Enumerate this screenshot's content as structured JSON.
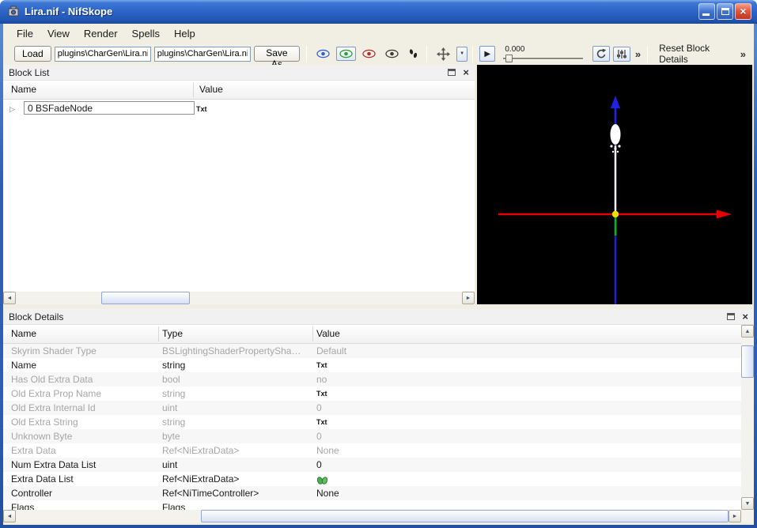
{
  "glyphs": {
    "close_x": "×",
    "overflow": "»",
    "dropdown": "▼",
    "play": "▶",
    "scroll_up": "▲",
    "scroll_down": "▼",
    "scroll_left": "◄",
    "scroll_right": "►",
    "expand": "▷"
  },
  "window": {
    "title": "Lira.nif - NifSkope"
  },
  "menu": {
    "items": [
      "File",
      "View",
      "Render",
      "Spells",
      "Help"
    ]
  },
  "toolbar": {
    "load_label": "Load",
    "load_path": "plugins\\CharGen\\Lira.nif",
    "save_path": "plugins\\CharGen\\Lira.nif",
    "save_as_label": "Save As",
    "time_value": "0.000",
    "reset_label": "Reset Block Details",
    "icons": [
      "axes-eye-blue",
      "nodes-eye-green",
      "properties-eye-red",
      "hidden-eye-dark",
      "furniture-footprints",
      "move-tool",
      "dropdown",
      "play",
      "rotate-animation",
      "render-settings-bars"
    ]
  },
  "block_list": {
    "title": "Block List",
    "columns": [
      "Name",
      "Value"
    ],
    "root_row": {
      "name": "0 BSFadeNode",
      "value": "Txt"
    }
  },
  "viewport": {
    "background": "#000000",
    "axis_colors": {
      "x_axis": "#e60000",
      "z_axis_up": "#2222e6",
      "z_axis_down": "#2222cc",
      "bone": "#ffffff",
      "selection": "#00c000",
      "center": "#f0e000"
    }
  },
  "block_details": {
    "title": "Block Details",
    "columns": [
      "Name",
      "Type",
      "Value"
    ],
    "rows": [
      {
        "name": "Skyrim Shader Type",
        "type": "BSLightingShaderPropertySha…",
        "value": "Default"
      },
      {
        "name": "Name",
        "type": "string",
        "value": "Txt"
      },
      {
        "name": "Has Old Extra Data",
        "type": "bool",
        "value": "no"
      },
      {
        "name": "Old Extra Prop Name",
        "type": "string",
        "value": "Txt"
      },
      {
        "name": "Old Extra Internal Id",
        "type": "uint",
        "value": "0"
      },
      {
        "name": "Old Extra String",
        "type": "string",
        "value": "Txt"
      },
      {
        "name": "Unknown Byte",
        "type": "byte",
        "value": "0"
      },
      {
        "name": "Extra Data",
        "type": "Ref<NiExtraData>",
        "value": "None"
      },
      {
        "name": "Num Extra Data List",
        "type": "uint",
        "value": "0"
      },
      {
        "name": "Extra Data List",
        "type": "Ref<NiExtraData>",
        "value": ""
      },
      {
        "name": "Controller",
        "type": "Ref<NiTimeController>",
        "value": "None"
      },
      {
        "name": "Flags",
        "type": "Flags",
        "value": ""
      }
    ]
  }
}
